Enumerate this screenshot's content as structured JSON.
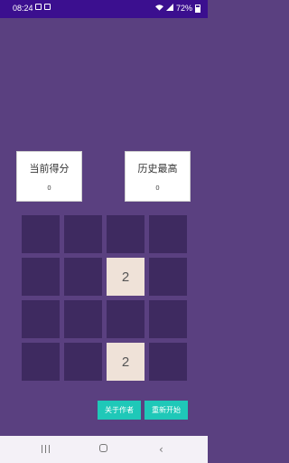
{
  "status_bar": {
    "time": "08:24",
    "battery": "72%"
  },
  "scores": {
    "current_label": "当前得分",
    "current_value": "0",
    "best_label": "历史最高",
    "best_value": "0"
  },
  "board": {
    "rows": 4,
    "cols": 4,
    "cells": [
      [
        "",
        "",
        "",
        ""
      ],
      [
        "",
        "",
        "2",
        ""
      ],
      [
        "",
        "",
        "",
        ""
      ],
      [
        "",
        "",
        "2",
        ""
      ]
    ]
  },
  "buttons": {
    "about_label": "关于作者",
    "restart_label": "重新开始"
  },
  "colors": {
    "background": "#5a4080",
    "empty_cell": "#3e2a60",
    "tile_2": "#efe2d8",
    "button": "#1fc8b8",
    "status_bar": "#3b0f8f"
  },
  "nav_bar": {
    "recent_icon": "recent-apps-icon",
    "home_icon": "home-icon",
    "back_icon": "back-icon"
  }
}
